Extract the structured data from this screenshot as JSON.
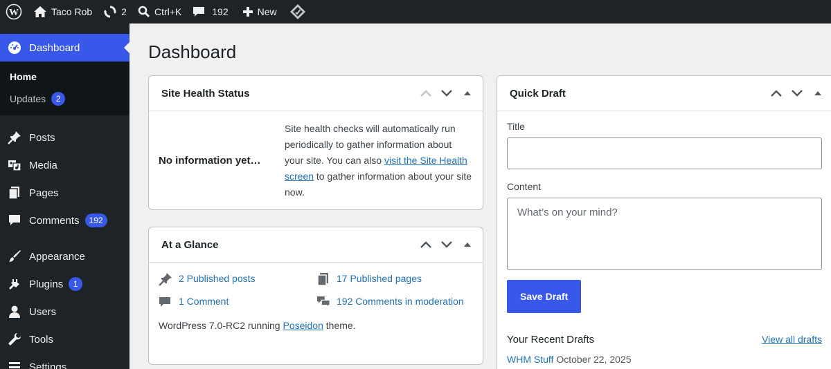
{
  "adminbar": {
    "site_name": "Taco Rob",
    "updates_count": "2",
    "search_shortcut": "Ctrl+K",
    "comments_count": "192",
    "new_label": "New"
  },
  "sidebar": {
    "current": {
      "label": "Dashboard"
    },
    "submenu": [
      {
        "label": "Home"
      },
      {
        "label": "Updates",
        "badge": "2"
      }
    ],
    "items": [
      {
        "label": "Posts",
        "icon": "pushpin-icon"
      },
      {
        "label": "Media",
        "icon": "media-icon"
      },
      {
        "label": "Pages",
        "icon": "pages-icon"
      },
      {
        "label": "Comments",
        "icon": "comment-icon",
        "badge": "192"
      },
      {
        "label": "Appearance",
        "icon": "brush-icon"
      },
      {
        "label": "Plugins",
        "icon": "plugin-icon",
        "badge": "1"
      },
      {
        "label": "Users",
        "icon": "user-icon"
      },
      {
        "label": "Tools",
        "icon": "wrench-icon"
      },
      {
        "label": "Settings",
        "icon": "settings-icon"
      }
    ]
  },
  "main": {
    "title": "Dashboard",
    "site_health": {
      "title": "Site Health Status",
      "status": "No information yet…",
      "text_before": "Site health checks will automatically run periodically to gather information about your site. You can also ",
      "link": "visit the Site Health screen",
      "text_after": " to gather information about your site now."
    },
    "at_a_glance": {
      "title": "At a Glance",
      "items": [
        {
          "label": "2 Published posts",
          "icon": "pushpin-icon"
        },
        {
          "label": "17 Published pages",
          "icon": "pages-icon"
        },
        {
          "label": "1 Comment",
          "icon": "comment-icon"
        },
        {
          "label": "192 Comments in moderation",
          "icon": "comments-icon"
        }
      ],
      "version_prefix": "WordPress 7.0-RC2 running ",
      "theme": "Poseidon",
      "version_suffix": " theme."
    },
    "quick_draft": {
      "title": "Quick Draft",
      "title_label": "Title",
      "title_value": "",
      "content_label": "Content",
      "content_placeholder": "What’s on your mind?",
      "save_label": "Save Draft",
      "recent_title": "Your Recent Drafts",
      "view_all": "View all drafts",
      "drafts": [
        {
          "title": "WHM Stuff",
          "date": "October 22, 2025"
        }
      ]
    }
  },
  "colors": {
    "admin_bar": "#1d2327",
    "accent": "#3858e9",
    "link": "#2271b1",
    "background": "#f0f0f1"
  }
}
